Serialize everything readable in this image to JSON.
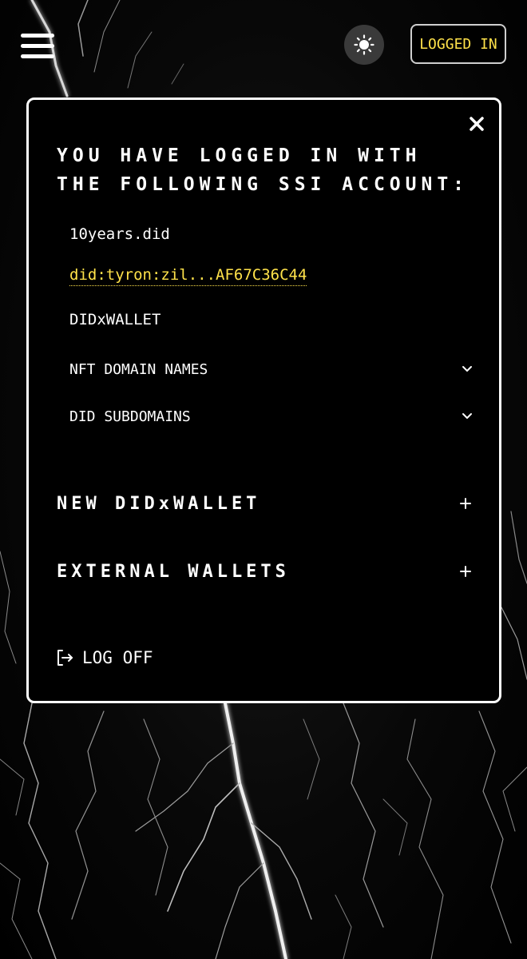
{
  "header": {
    "menu_icon": "hamburger-menu-icon",
    "theme_icon": "sun-icon",
    "login_status_label": "LOGGED IN",
    "accent_color": "#ffe24a"
  },
  "modal": {
    "close_icon": "close-icon",
    "title": "YOU HAVE LOGGED IN WITH THE FOLLOWING SSI ACCOUNT:",
    "account_name": "10years.did",
    "did_address": "did:tyron:zil...AF67C36C44",
    "didx_wallet_label": "DIDxWALLET",
    "nft_domain_names_label": "NFT DOMAIN NAMES",
    "did_subdomains_label": "DID SUBDOMAINS",
    "dropdown_icon": "chevron-down-icon",
    "new_didx_wallet_label": "NEW DIDxWALLET",
    "external_wallets_label": "EXTERNAL WALLETS",
    "expand_icon": "plus-icon",
    "logoff_icon": "logout-icon",
    "logoff_label": "LOG OFF"
  }
}
